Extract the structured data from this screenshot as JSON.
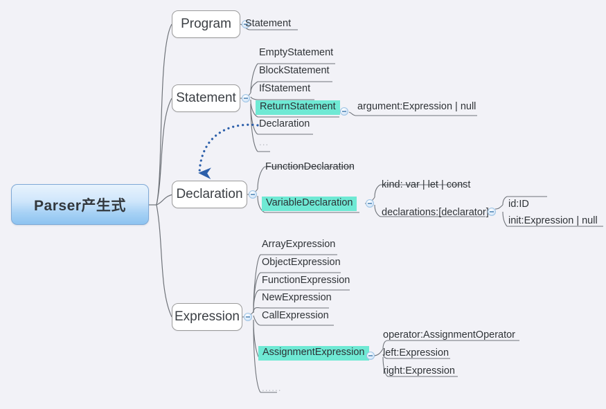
{
  "app": {
    "title": "Parser产生式",
    "background_color": "#f2f2f7",
    "highlight_color": "#6fe9d4",
    "root_accent_color": "#8dc3f0",
    "arrow_color": "#2c5faa",
    "link_color": "#6e7278"
  },
  "root": {
    "label": "Parser产生式"
  },
  "branches": [
    {
      "label": "Program",
      "children": [
        {
          "label": "Statement",
          "highlight": false,
          "children": []
        }
      ]
    },
    {
      "label": "Statement",
      "children": [
        {
          "label": "EmptyStatement",
          "highlight": false,
          "children": []
        },
        {
          "label": "BlockStatement",
          "highlight": false,
          "children": []
        },
        {
          "label": "IfStatement",
          "highlight": false,
          "children": []
        },
        {
          "label": "ReturnStatement",
          "highlight": true,
          "children": [
            {
              "label": "argument:Expression | null",
              "children": []
            }
          ]
        },
        {
          "label": "Declaration",
          "highlight": false,
          "children": []
        },
        {
          "label": "...",
          "highlight": false,
          "faint": true,
          "children": []
        }
      ]
    },
    {
      "label": "Declaration",
      "children": [
        {
          "label": "FunctionDeclaration",
          "highlight": false,
          "children": []
        },
        {
          "label": "VariableDeclaration",
          "highlight": true,
          "children": [
            {
              "label": "kind: var | let | const",
              "children": []
            },
            {
              "label": "declarations:[declarator]",
              "children": [
                {
                  "label": "id:ID"
                },
                {
                  "label": "init:Expression | null"
                }
              ]
            }
          ]
        }
      ]
    },
    {
      "label": "Expression",
      "children": [
        {
          "label": "ArrayExpression",
          "highlight": false,
          "children": []
        },
        {
          "label": "ObjectExpression",
          "highlight": false,
          "children": []
        },
        {
          "label": "FunctionExpression",
          "highlight": false,
          "children": []
        },
        {
          "label": "NewExpression",
          "highlight": false,
          "children": []
        },
        {
          "label": "CallExpression",
          "highlight": false,
          "children": []
        },
        {
          "label": "AssignmentExpression",
          "highlight": true,
          "children": [
            {
              "label": "operator:AssignmentOperator",
              "children": []
            },
            {
              "label": "left:Expression",
              "children": []
            },
            {
              "label": "right:Expression",
              "children": []
            }
          ]
        },
        {
          "label": "......",
          "highlight": false,
          "faint": true,
          "children": []
        }
      ]
    }
  ],
  "relation_arrow": {
    "from": "Declaration (under Statement)",
    "to": "Declaration (branch node)",
    "style": "dotted-curved-arrow"
  }
}
